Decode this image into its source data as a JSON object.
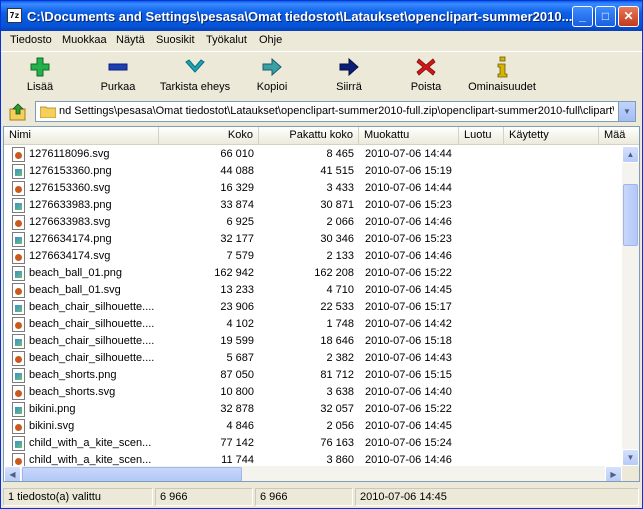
{
  "window": {
    "title": "C:\\Documents and Settings\\pesasa\\Omat tiedostot\\Lataukset\\openclipart-summer2010...",
    "app_icon_text": "7z"
  },
  "menu": [
    "Tiedosto",
    "Muokkaa",
    "Näytä",
    "Suosikit",
    "Työkalut",
    "Ohje"
  ],
  "toolbar": {
    "add": "Lisää",
    "extract": "Purkaa",
    "test": "Tarkista eheys",
    "copy": "Kopioi",
    "move": "Siirrä",
    "delete": "Poista",
    "info": "Ominaisuudet"
  },
  "address": {
    "path": "nd Settings\\pesasa\\Omat tiedostot\\Lataukset\\openclipart-summer2010-full.zip\\openclipart-summer2010-full\\clipart\\"
  },
  "columns": [
    "Nimi",
    "Koko",
    "Pakattu koko",
    "Muokattu",
    "Luotu",
    "Käytetty",
    "Mää"
  ],
  "files": [
    {
      "name": "1276118096.svg",
      "size": "66 010",
      "packed": "8 465",
      "modified": "2010-07-06 14:44",
      "type": "svg"
    },
    {
      "name": "1276153360.png",
      "size": "44 088",
      "packed": "41 515",
      "modified": "2010-07-06 15:19",
      "type": "png"
    },
    {
      "name": "1276153360.svg",
      "size": "16 329",
      "packed": "3 433",
      "modified": "2010-07-06 14:44",
      "type": "svg"
    },
    {
      "name": "1276633983.png",
      "size": "33 874",
      "packed": "30 871",
      "modified": "2010-07-06 15:23",
      "type": "png"
    },
    {
      "name": "1276633983.svg",
      "size": "6 925",
      "packed": "2 066",
      "modified": "2010-07-06 14:46",
      "type": "svg"
    },
    {
      "name": "1276634174.png",
      "size": "32 177",
      "packed": "30 346",
      "modified": "2010-07-06 15:23",
      "type": "png"
    },
    {
      "name": "1276634174.svg",
      "size": "7 579",
      "packed": "2 133",
      "modified": "2010-07-06 14:46",
      "type": "svg"
    },
    {
      "name": "beach_ball_01.png",
      "size": "162 942",
      "packed": "162 208",
      "modified": "2010-07-06 15:22",
      "type": "png"
    },
    {
      "name": "beach_ball_01.svg",
      "size": "13 233",
      "packed": "4 710",
      "modified": "2010-07-06 14:45",
      "type": "svg"
    },
    {
      "name": "beach_chair_silhouette....",
      "size": "23 906",
      "packed": "22 533",
      "modified": "2010-07-06 15:17",
      "type": "png"
    },
    {
      "name": "beach_chair_silhouette....",
      "size": "4 102",
      "packed": "1 748",
      "modified": "2010-07-06 14:42",
      "type": "svg"
    },
    {
      "name": "beach_chair_silhouette....",
      "size": "19 599",
      "packed": "18 646",
      "modified": "2010-07-06 15:18",
      "type": "png"
    },
    {
      "name": "beach_chair_silhouette....",
      "size": "5 687",
      "packed": "2 382",
      "modified": "2010-07-06 14:43",
      "type": "svg"
    },
    {
      "name": "beach_shorts.png",
      "size": "87 050",
      "packed": "81 712",
      "modified": "2010-07-06 15:15",
      "type": "png"
    },
    {
      "name": "beach_shorts.svg",
      "size": "10 800",
      "packed": "3 638",
      "modified": "2010-07-06 14:40",
      "type": "svg"
    },
    {
      "name": "bikini.png",
      "size": "32 878",
      "packed": "32 057",
      "modified": "2010-07-06 15:22",
      "type": "png"
    },
    {
      "name": "bikini.svg",
      "size": "4 846",
      "packed": "2 056",
      "modified": "2010-07-06 14:45",
      "type": "svg"
    },
    {
      "name": "child_with_a_kite_scen...",
      "size": "77 142",
      "packed": "76 163",
      "modified": "2010-07-06 15:24",
      "type": "png"
    },
    {
      "name": "child_with_a_kite_scen...",
      "size": "11 744",
      "packed": "3 860",
      "modified": "2010-07-06 14:46",
      "type": "svg"
    }
  ],
  "status": {
    "selected": "1 tiedosto(a) valittu",
    "size": "6 966",
    "packed": "6 966",
    "modified": "2010-07-06 14:45"
  },
  "colors": {
    "titlebar": "#0453d6",
    "add": "#22b14c",
    "extract": "#1c3fb4",
    "test": "#1aa6b8",
    "move": "#0b1f7a",
    "delete": "#d01818",
    "info": "#d8b400"
  }
}
